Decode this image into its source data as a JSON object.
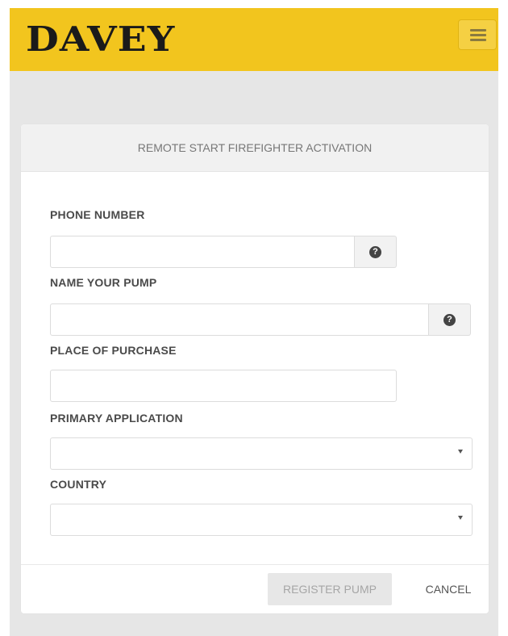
{
  "header": {
    "logo_text": "DAVEY",
    "brand_color": "#f2c51e",
    "menu_icon": "hamburger-menu-icon"
  },
  "form": {
    "title": "REMOTE START FIREFIGHTER ACTIVATION",
    "fields": {
      "phone": {
        "label": "PHONE NUMBER",
        "value": "",
        "help_icon": "?"
      },
      "pump_name": {
        "label": "NAME YOUR PUMP",
        "value": "",
        "help_icon": "?"
      },
      "place_of_purchase": {
        "label": "PLACE OF PURCHASE",
        "value": ""
      },
      "primary_application": {
        "label": "PRIMARY APPLICATION",
        "selected": ""
      },
      "country": {
        "label": "COUNTRY",
        "selected": ""
      }
    }
  },
  "footer": {
    "register_label": "REGISTER PUMP",
    "cancel_label": "CANCEL"
  }
}
